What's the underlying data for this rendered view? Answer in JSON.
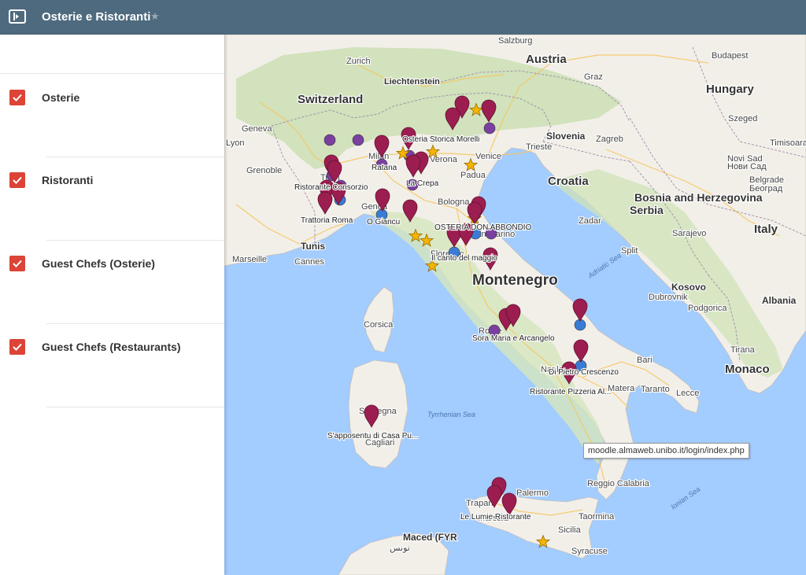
{
  "header": {
    "title": "Osterie e Ristoranti",
    "panel_icon": "sidebar-toggle-icon",
    "star_icon": "star-icon"
  },
  "layers": [
    {
      "label": "Osterie",
      "checked": true
    },
    {
      "label": "Ristoranti",
      "checked": true
    },
    {
      "label": "Guest Chefs (Osterie)",
      "checked": true
    },
    {
      "label": "Guest Chefs (Restaurants)",
      "checked": true
    }
  ],
  "colors": {
    "header": "#4e6a7e",
    "checkbox": "#db4437",
    "osterie_pin": "#9c1e50",
    "ristoranti_dot": "#7b3fa0",
    "guest_osterie_dot": "#3a7bd5",
    "guest_restaurant_star": "#f4b400",
    "sea": "#a3ccff",
    "land": "#f2efe9"
  },
  "map": {
    "countries": [
      "Austria",
      "Hungary",
      "Switzerland",
      "Liechtenstein",
      "Slovenia",
      "Croatia",
      "Bosnia and Herzegovina",
      "Serbia",
      "Italy",
      "Montenegro",
      "Kosovo",
      "Albania",
      "Monaco",
      "Tunis",
      "Maced (FYR"
    ],
    "cities": [
      "Salzburg",
      "Budapest",
      "Zurich",
      "Graz",
      "Szeged",
      "Geneva",
      "Lyon",
      "Grenoble",
      "Timisoara",
      "Novi Sad",
      "Нови Сад",
      "Belgrade",
      "Београд",
      "Zagreb",
      "Trieste",
      "Venice",
      "Padua",
      "Verona",
      "Milan",
      "Turin",
      "Genoa",
      "Bologna",
      "Florence",
      "San Marino",
      "Marseille",
      "Cannes",
      "Zadar",
      "Split",
      "Sarajevo",
      "Dubrovnik",
      "Podgorica",
      "Tirana",
      "Bari",
      "Naples",
      "Matera",
      "Taranto",
      "Lecce",
      "Rome",
      "Sardegna",
      "Cagliari",
      "Palermo",
      "Trapani",
      "Marsala",
      "Reggio Calabria",
      "Taormina",
      "Sicilia",
      "Syracuse",
      "Corsica",
      "تونس"
    ],
    "seas": [
      "Adriatic Sea",
      "Tyrrhenian Sea",
      "Ionian Sea"
    ],
    "place_labels": [
      "Osteria Storica Morelli",
      "Ratana",
      "La Crepa",
      "Ristorante Consorzio",
      "Trattoria Roma",
      "O Giancu",
      "OSTERIA DON ABBONDIO",
      "Il canto del maggio",
      "Sora Maria e Arcangelo",
      "Di Pietro Crescenzo",
      "Ristorante Pizzeria Al...",
      "S'apposentu di Casa Pu...",
      "Le Lumie Ristorante"
    ],
    "tooltip": "moodle.almaweb.unibo.it/login/index.php"
  }
}
